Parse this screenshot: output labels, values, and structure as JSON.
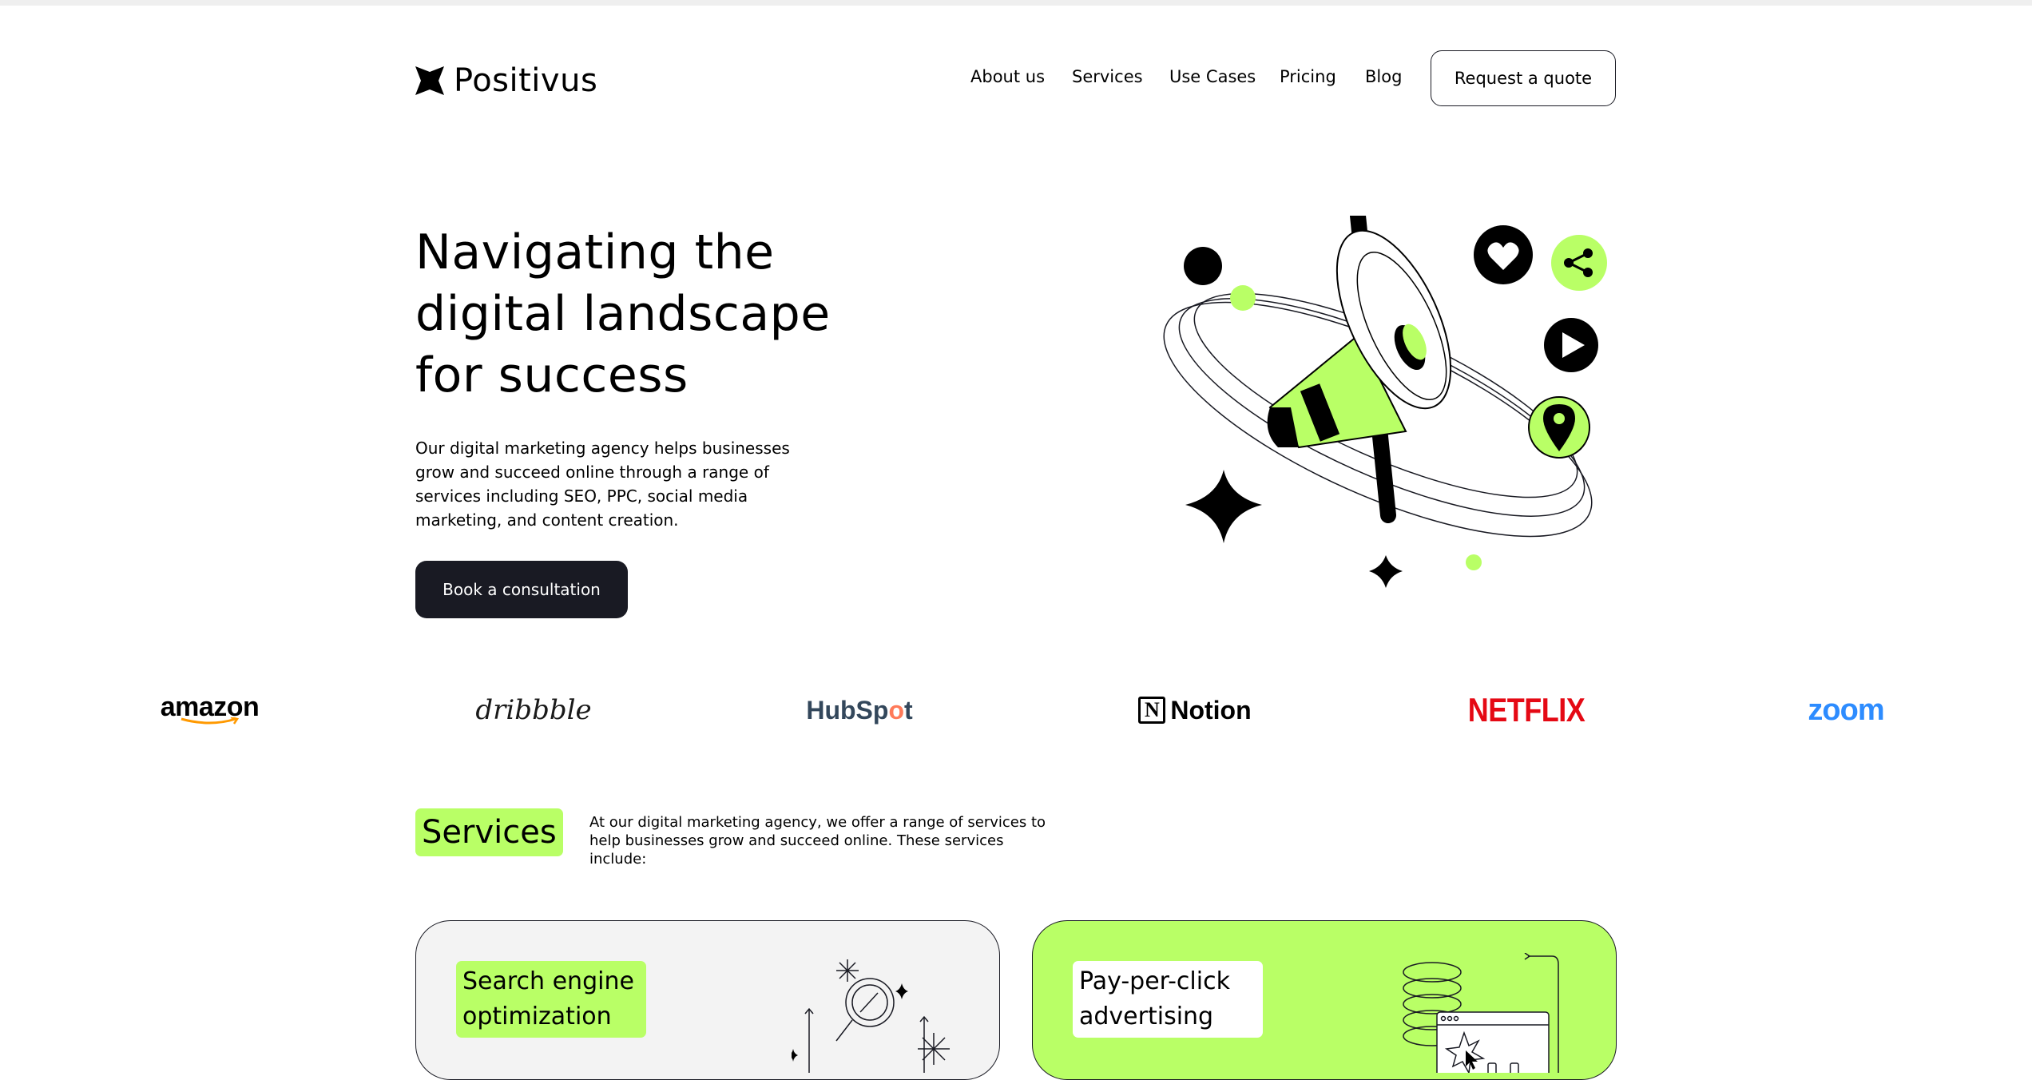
{
  "header": {
    "brand": "Positivus",
    "nav": [
      {
        "label": "About us"
      },
      {
        "label": "Services"
      },
      {
        "label": "Use Cases"
      },
      {
        "label": "Pricing"
      },
      {
        "label": "Blog"
      }
    ],
    "cta": "Request a quote"
  },
  "hero": {
    "title": "Navigating the digital landscape for success",
    "description": "Our digital marketing agency helps businesses grow and succeed online through a range of services including SEO, PPC, social media marketing, and content creation.",
    "cta": "Book a consultation"
  },
  "brands": {
    "amazon": "amazon",
    "dribbble": "dribbble",
    "hubspot_a": "HubSp",
    "hubspot_b": "o",
    "hubspot_c": "t",
    "notion_mark": "N",
    "notion": "Notion",
    "netflix": "NETFLIX",
    "zoom": "zoom"
  },
  "services": {
    "heading": "Services",
    "intro": "At our digital marketing agency, we offer a range of services to help businesses grow and succeed online. These services include:",
    "cards": [
      {
        "title": "Search engine optimization"
      },
      {
        "title": "Pay-per-click advertising"
      }
    ]
  },
  "colors": {
    "accent": "#b9ff66",
    "dark": "#191a23",
    "card_gray": "#f3f3f3",
    "netflix": "#e50914",
    "zoom": "#2d8cff",
    "hubspot": "#33475b",
    "hubspot_dot": "#ff7a59"
  },
  "icons": {
    "logo": "positivus-star-icon",
    "hero": [
      "megaphone-icon",
      "heart-icon",
      "share-icon",
      "play-icon",
      "location-pin-icon",
      "sparkle-star-icon"
    ]
  }
}
